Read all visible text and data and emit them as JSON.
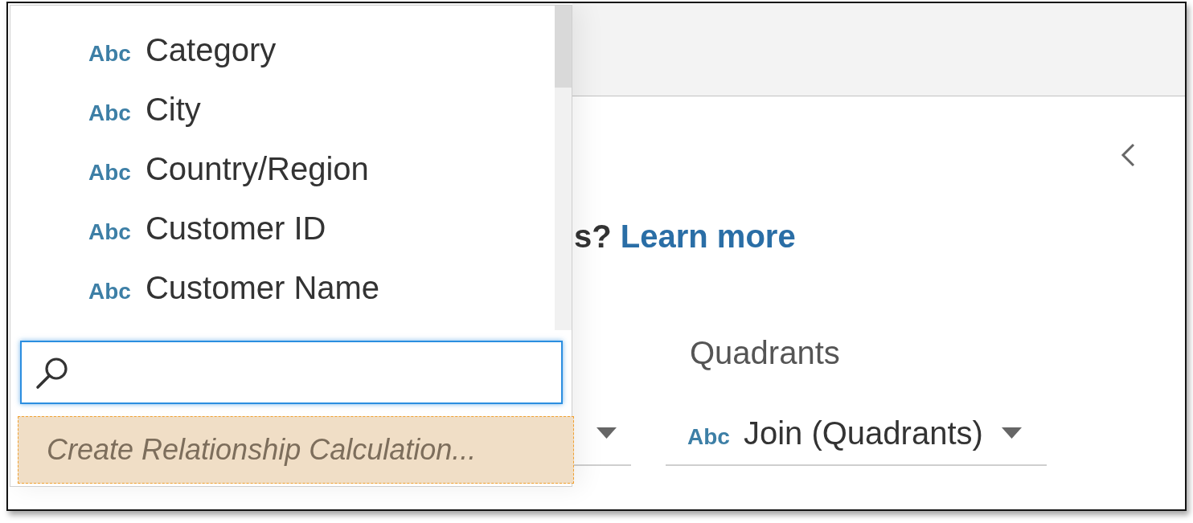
{
  "help": {
    "text": "s?",
    "link": "Learn more"
  },
  "relationship": {
    "right_table": "Quadrants",
    "right_field": {
      "type": "Abc",
      "value": "Join (Quadrants)"
    }
  },
  "field_menu": {
    "items": [
      {
        "type": "Abc",
        "label": "Category",
        "selected": false
      },
      {
        "type": "Abc",
        "label": "City",
        "selected": false
      },
      {
        "type": "Abc",
        "label": "Country/Region",
        "selected": false
      },
      {
        "type": "Abc",
        "label": "Customer ID",
        "selected": false
      },
      {
        "type": "Abc",
        "label": "Customer Name",
        "selected": false
      }
    ],
    "search": {
      "focused": true
    },
    "create_action": {
      "label": "Create Relationship Calculation...",
      "highlighted": true
    }
  }
}
